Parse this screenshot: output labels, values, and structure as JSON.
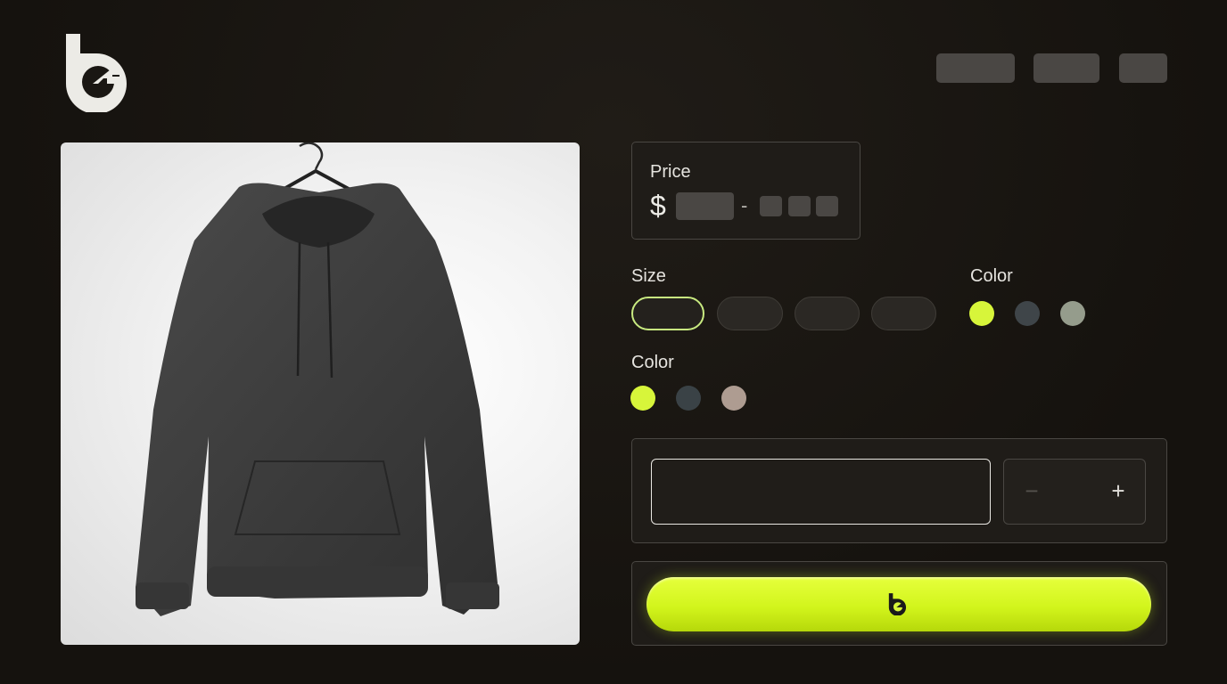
{
  "header": {
    "logo_icon": "brand-logo-icon",
    "nav_placeholders": 3
  },
  "product": {
    "image_icon": "hoodie-image"
  },
  "price": {
    "label": "Price",
    "currency": "$",
    "separator": "-"
  },
  "size": {
    "label": "Size",
    "options_count": 4,
    "selected_index": 0
  },
  "color_primary": {
    "label": "Color",
    "swatches": [
      "#d7f53a",
      "#3f4549",
      "#959c8c"
    ],
    "selected_index": 0
  },
  "color_secondary": {
    "label": "Color",
    "swatches": [
      "#d7f53a",
      "#3a4246",
      "#ae9c91"
    ],
    "selected_index": 0
  },
  "quantity": {
    "minus_icon": "minus-icon",
    "plus_icon": "plus-icon",
    "minus_symbol": "−",
    "plus_symbol": "+"
  },
  "cta": {
    "icon": "brand-logo-icon",
    "accent_color": "#d7f53a"
  }
}
